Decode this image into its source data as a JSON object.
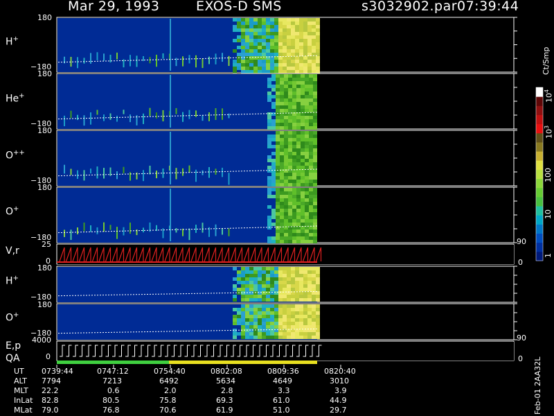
{
  "header": {
    "date": "Mar 29, 1993",
    "instrument": "EXOS-D SMS",
    "file": "s3032902.par",
    "time": "07:39:44"
  },
  "panels": [
    {
      "ion": "H",
      "charge": "+",
      "ymax": "180",
      "ymin": "−180"
    },
    {
      "ion": "He",
      "charge": "+",
      "ymax": "180",
      "ymin": "−180"
    },
    {
      "ion": "O",
      "charge": "++",
      "ymax": "180",
      "ymin": "−180"
    },
    {
      "ion": "O",
      "charge": "+",
      "ymax": "180",
      "ymin": "−180"
    },
    {
      "label": "V,r",
      "ymax": "25",
      "ymin": "0",
      "right_top": "90",
      "right_bottom": "0"
    },
    {
      "ion": "H",
      "charge": "+",
      "ymax": "180",
      "ymin": "−180"
    },
    {
      "ion": "O",
      "charge": "+",
      "ymax": "180",
      "ymin": "−180"
    },
    {
      "label_top": "E,p",
      "label_bottom": "QA",
      "ymax": "4000",
      "ymin": "0",
      "right_top": "90",
      "right_bottom": "0"
    }
  ],
  "colorbar": {
    "unit": "Ct/Smp",
    "ticks": [
      "1",
      "10",
      "100",
      "10",
      "10"
    ],
    "exps": [
      "",
      "",
      "",
      "3",
      "4"
    ]
  },
  "ephemeris": {
    "rows": [
      "UT",
      "ALT",
      "MLT",
      "InLat",
      "MLat"
    ],
    "columns": [
      [
        "0739:44",
        "7794",
        "22.2",
        "82.8",
        "79.0"
      ],
      [
        "0747:12",
        "7213",
        "0.6",
        "80.5",
        "76.8"
      ],
      [
        "0754:40",
        "6492",
        "2.0",
        "75.8",
        "70.6"
      ],
      [
        "0802:08",
        "5634",
        "2.8",
        "69.3",
        "61.9"
      ],
      [
        "0809:36",
        "4649",
        "3.3",
        "61.0",
        "51.0"
      ],
      [
        "0820:40",
        "3010",
        "3.9",
        "44.9",
        "29.7"
      ]
    ]
  },
  "footer": "Feb-01 2AA32L",
  "colors": {
    "background": "#000000",
    "field": "#002b95",
    "dense": "#6fcf2a",
    "peak": "#e8e850",
    "vr": "#e02020"
  },
  "chart_data": {
    "type": "heatmap",
    "title": "Mar 29, 1993  EXOS-D SMS",
    "x_tick_labels": [
      "0739:44",
      "0747:12",
      "0754:40",
      "0802:08",
      "0809:36",
      "0820:40"
    ],
    "y_range": [
      -180,
      180
    ],
    "scale": "log",
    "color_range": [
      1,
      10000
    ]
  }
}
